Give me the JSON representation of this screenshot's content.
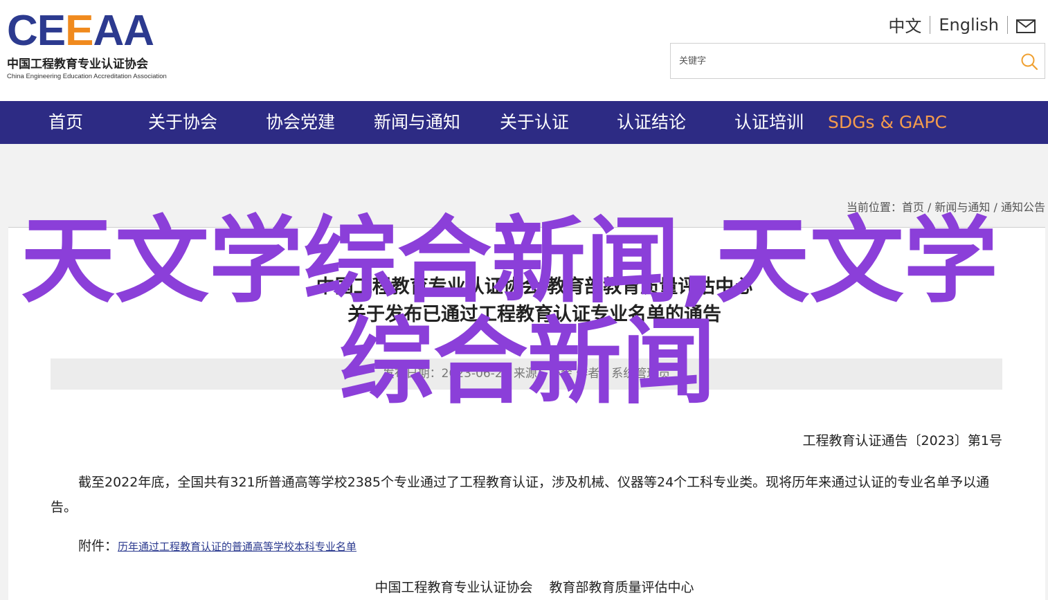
{
  "logo": {
    "mark_1": "CE",
    "mark_2": "E",
    "mark_3": "AA",
    "name_cn": "中国工程教育专业认证协会",
    "name_en": "China Engineering Education Accreditation Association"
  },
  "lang": {
    "zh": "中文",
    "en": "English",
    "mail_icon": "mail-icon"
  },
  "search": {
    "placeholder": "关键字",
    "icon": "search-icon"
  },
  "nav": {
    "items": [
      "首页",
      "关于协会",
      "协会党建",
      "新闻与通知",
      "关于认证",
      "认证结论",
      "认证培训",
      "SDGs & GAPC"
    ]
  },
  "breadcrumb": {
    "prefix": "当前位置：",
    "home": "首页",
    "sep": " / ",
    "section": "新闻与通知",
    "current": "通知公告"
  },
  "article": {
    "title_line1": "中国工程教育专业认证协会 教育部教育质量评估中心",
    "title_line2": "关于发布已通过工程教育认证专业名单的通告",
    "meta": "发布日期：2023-06-28  来源：协会  作者：系统管理员",
    "doc_no": "工程教育认证通告〔2023〕第1号",
    "paragraph": "截至2022年底，全国共有321所普通高等学校2385个专业通过了工程教育认证，涉及机械、仪器等24个工科专业类。现将历年来通过认证的专业名单予以通告。",
    "attach_label": "附件：",
    "attach_link": "历年通过工程教育认证的普通高等学校本科专业名单",
    "signer_1": "中国工程教育专业认证协会",
    "signer_2": "教育部教育质量评估中心"
  },
  "overlay": {
    "line1": "天文学综合新闻,天文学",
    "line2": "综合新闻",
    "color": "#8b3fd9"
  },
  "colors": {
    "nav_bg": "#2d2b84",
    "nav_highlight": "#f39b4d",
    "logo_blue": "#2c3a8f",
    "logo_orange": "#f08a1e"
  }
}
